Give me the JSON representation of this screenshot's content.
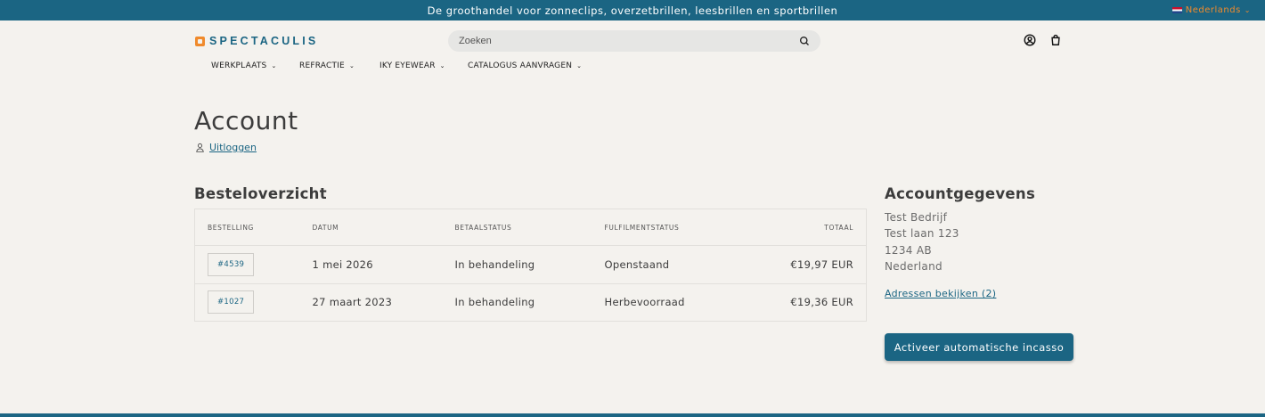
{
  "announcement": "De groothandel voor zonneclips, overzetbrillen, leesbrillen en sportbrillen",
  "language": "Nederlands",
  "logo_text": "SPECTACULIS",
  "search": {
    "placeholder": "Zoeken"
  },
  "nav": [
    {
      "label": "WERKPLAATS"
    },
    {
      "label": "REFRACTIE"
    },
    {
      "label": "IKY EYEWEAR"
    },
    {
      "label": "CATALOGUS AANVRAGEN"
    }
  ],
  "page_title": "Account",
  "logout_label": "Uitloggen",
  "orders": {
    "title": "Besteloverzicht",
    "columns": [
      "BESTELLING",
      "DATUM",
      "BETAALSTATUS",
      "FULFILMENTSTATUS",
      "TOTAAL"
    ],
    "rows": [
      {
        "order": "#4539",
        "date": "1 mei 2026",
        "payment": "In behandeling",
        "fulfillment": "Openstaand",
        "total": "€19,97 EUR"
      },
      {
        "order": "#1027",
        "date": "27 maart 2023",
        "payment": "In behandeling",
        "fulfillment": "Herbevoorraad",
        "total": "€19,36 EUR"
      }
    ]
  },
  "account": {
    "title": "Accountgegevens",
    "lines": [
      "Test Bedrijf",
      "Test laan 123",
      "1234 AB",
      "Nederland"
    ],
    "addresses_link": "Adressen bekijken (2)",
    "cta_label": "Activeer automatische incasso"
  },
  "colors": {
    "brand": "#1b6583",
    "accent": "#f08a2c",
    "background": "#f4f2ee"
  }
}
